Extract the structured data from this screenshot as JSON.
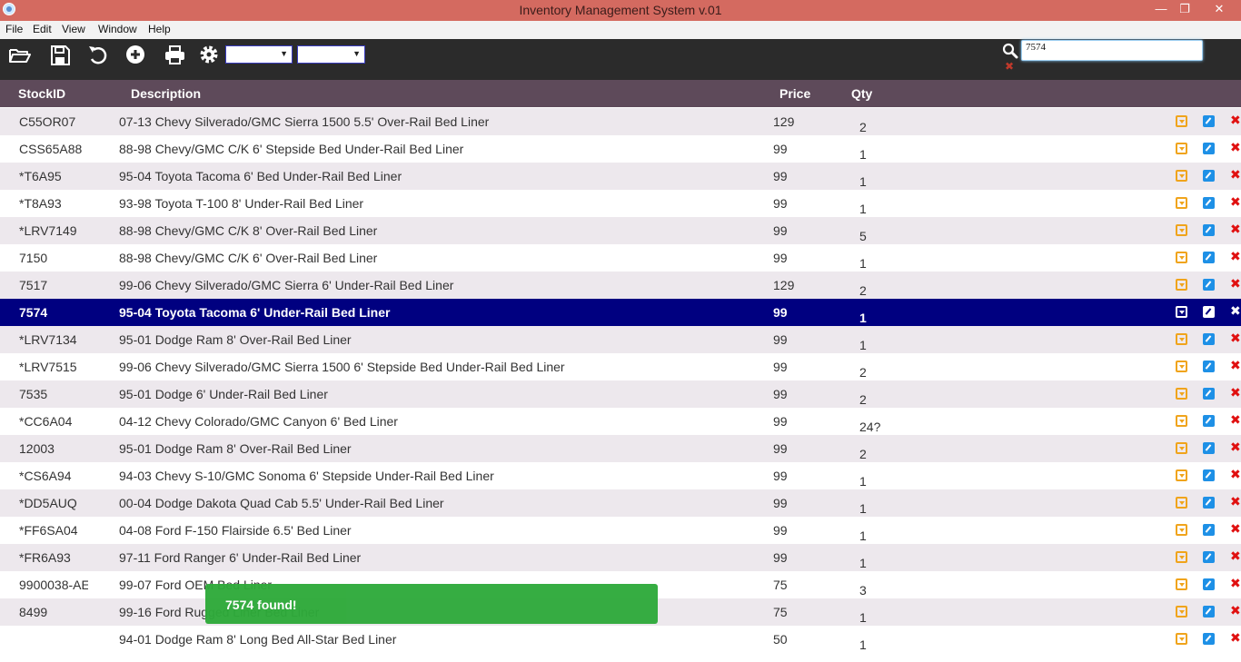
{
  "window": {
    "title": "Inventory Management System v.01",
    "minimize": "—",
    "maximize": "❐",
    "close": "✕"
  },
  "menu": [
    "File",
    "Edit",
    "View",
    "Window",
    "Help"
  ],
  "toolbar": {
    "icons": [
      "open-folder-icon",
      "save-icon",
      "undo-icon",
      "add-icon",
      "print-icon",
      "settings-icon"
    ],
    "dropdown1": "",
    "dropdown2": ""
  },
  "search": {
    "value": "7574",
    "clear": "✖"
  },
  "table": {
    "headers": {
      "id": "StockID",
      "desc": "Description",
      "price": "Price",
      "qty": "Qty"
    },
    "rows": [
      {
        "id": "C55OR07",
        "desc": "07-13 Chevy Silverado/GMC Sierra 1500 5.5' Over-Rail Bed Liner",
        "price": "129",
        "qty": "2"
      },
      {
        "id": "CSS65A88",
        "desc": "88-98 Chevy/GMC C/K 6' Stepside Bed Under-Rail Bed Liner",
        "price": "99",
        "qty": "1"
      },
      {
        "id": "*T6A95",
        "desc": "95-04 Toyota Tacoma 6' Bed Under-Rail Bed Liner",
        "price": "99",
        "qty": "1"
      },
      {
        "id": "*T8A93",
        "desc": "93-98 Toyota T-100 8' Under-Rail Bed Liner",
        "price": "99",
        "qty": "1"
      },
      {
        "id": "*LRV7149",
        "desc": "88-98 Chevy/GMC C/K 8' Over-Rail Bed Liner",
        "price": "99",
        "qty": "5"
      },
      {
        "id": "7150",
        "desc": "88-98 Chevy/GMC C/K 6' Over-Rail Bed Liner",
        "price": "99",
        "qty": "1"
      },
      {
        "id": "7517",
        "desc": "99-06 Chevy Silverado/GMC Sierra 6' Under-Rail Bed Liner",
        "price": "129",
        "qty": "2"
      },
      {
        "id": "7574",
        "desc": "95-04 Toyota Tacoma 6' Under-Rail Bed Liner",
        "price": "99",
        "qty": "1",
        "selected": true
      },
      {
        "id": "*LRV7134",
        "desc": "95-01 Dodge Ram 8' Over-Rail Bed Liner",
        "price": "99",
        "qty": "1"
      },
      {
        "id": "*LRV7515",
        "desc": "99-06 Chevy Silverado/GMC Sierra 1500 6' Stepside Bed Under-Rail Bed Liner",
        "price": "99",
        "qty": "2"
      },
      {
        "id": "7535",
        "desc": "95-01 Dodge 6' Under-Rail Bed Liner",
        "price": "99",
        "qty": "2"
      },
      {
        "id": "*CC6A04",
        "desc": "04-12 Chevy Colorado/GMC Canyon 6' Bed Liner",
        "price": "99",
        "qty": "24?"
      },
      {
        "id": "12003",
        "desc": "95-01 Dodge Ram 8' Over-Rail Bed Liner",
        "price": "99",
        "qty": "2"
      },
      {
        "id": "*CS6A94",
        "desc": "94-03 Chevy S-10/GMC Sonoma 6' Stepside Under-Rail Bed Liner",
        "price": "99",
        "qty": "1"
      },
      {
        "id": "*DD5AUQ",
        "desc": "00-04 Dodge Dakota Quad Cab 5.5' Under-Rail Bed Liner",
        "price": "99",
        "qty": "1"
      },
      {
        "id": "*FF6SA04",
        "desc": "04-08 Ford F-150 Flairside 6.5' Bed Liner",
        "price": "99",
        "qty": "1"
      },
      {
        "id": "*FR6A93",
        "desc": "97-11 Ford Ranger 6' Under-Rail Bed Liner",
        "price": "99",
        "qty": "1"
      },
      {
        "id": "9900038-AE",
        "desc": "99-07 Ford OEM Bed Liner",
        "price": "75",
        "qty": "3"
      },
      {
        "id": "8499",
        "desc": "99-16 Ford Rugged Liner Bed Liner",
        "price": "75",
        "qty": "1"
      },
      {
        "id": "",
        "desc": "94-01 Dodge Ram 8' Long Bed All-Star Bed Liner",
        "price": "50",
        "qty": "1"
      }
    ]
  },
  "toast": {
    "message": "7574 found!"
  },
  "colors": {
    "titlebar": "#d46a60",
    "toolbar": "#2b2b2b",
    "header": "#5e4a5a",
    "selected": "#000080",
    "toast": "#2eaa3a"
  }
}
